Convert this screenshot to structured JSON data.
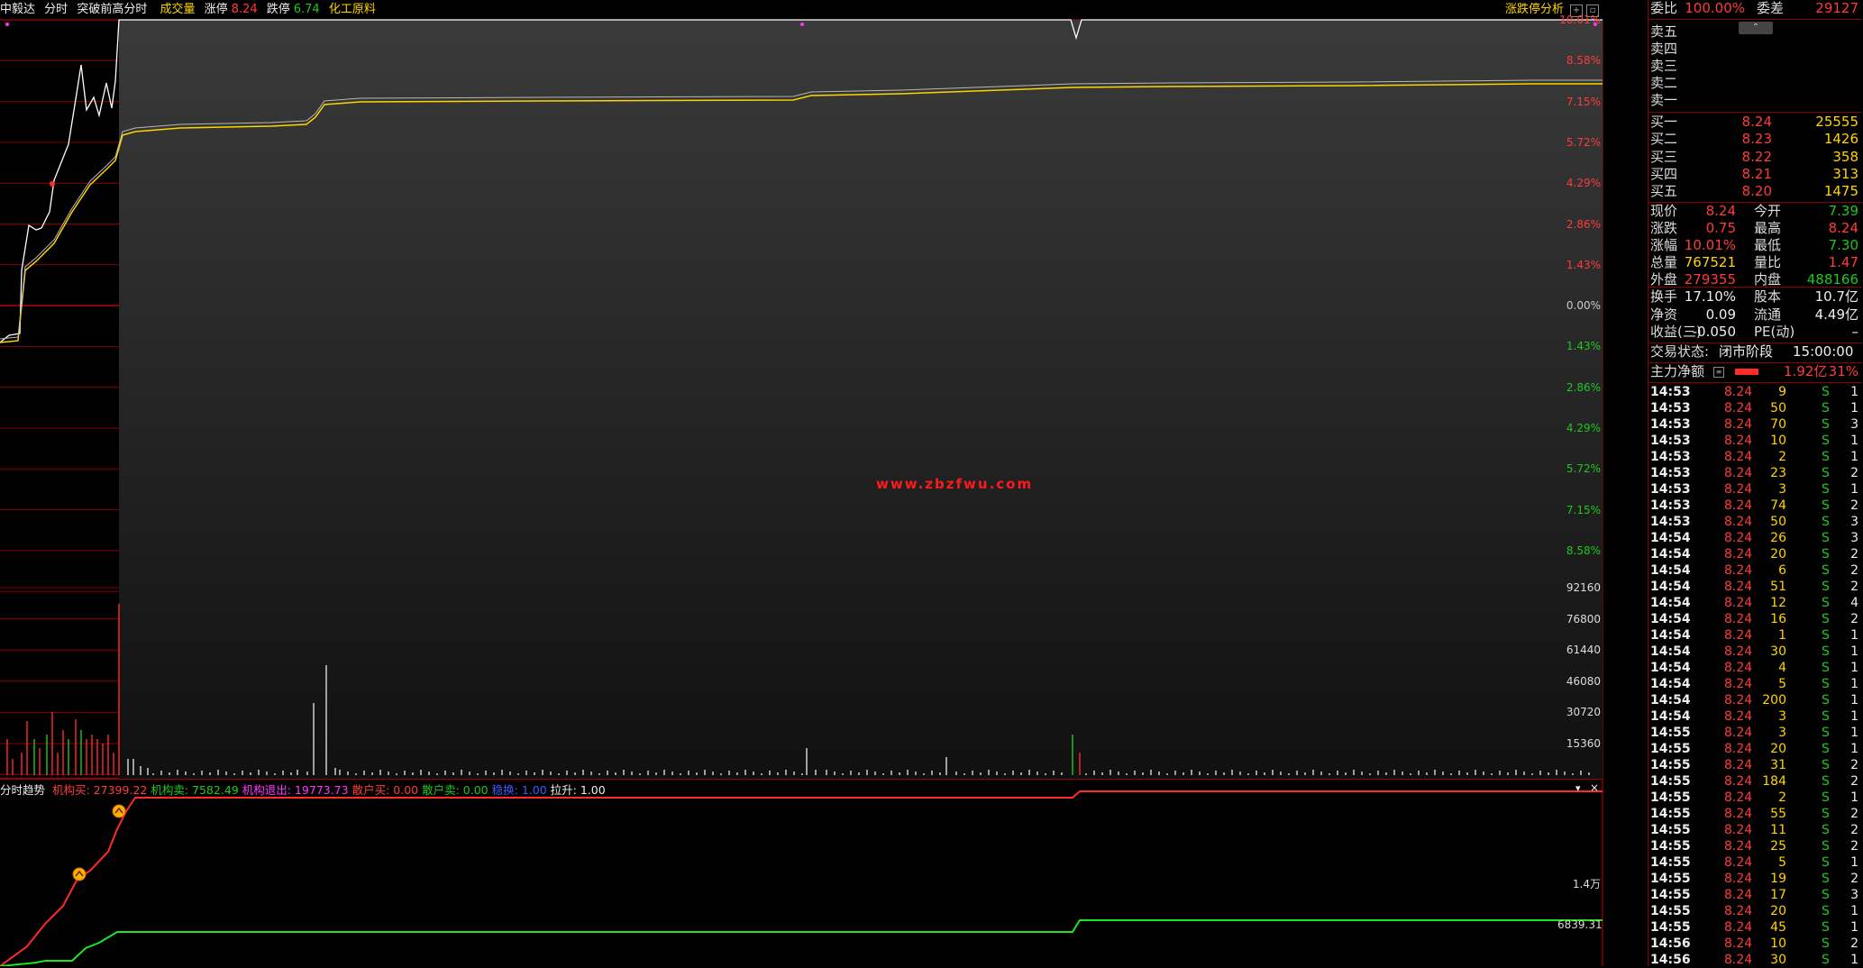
{
  "header": {
    "stock_name": "中毅达",
    "mode": "分时",
    "indicator": "突破前高分时",
    "volume_label": "成交量",
    "limit_up_label": "涨停",
    "limit_up_value": "8.24",
    "limit_down_label": "跌停",
    "limit_down_value": "6.74",
    "industry": "化工原料",
    "analysis_link": "涨跌停分析"
  },
  "price_axis": {
    "right_labels": [
      "10.01%",
      "8.58%",
      "7.15%",
      "5.72%",
      "4.29%",
      "2.86%",
      "1.43%",
      "0.00%",
      "1.43%",
      "2.86%",
      "4.29%",
      "5.72%",
      "7.15%",
      "8.58%"
    ],
    "colors": {
      "up": "#ff3b3b",
      "zero": "#cccccc",
      "down": "#1ec81e"
    }
  },
  "volume_axis": {
    "labels": [
      "92160",
      "76800",
      "61440",
      "46080",
      "30720",
      "15360"
    ]
  },
  "watermark": "www.zbzfwu.com",
  "sub_chart": {
    "title": "分时趋势",
    "items": [
      {
        "label": "机构买:",
        "value": "27399.22",
        "color": "#ff3b3b"
      },
      {
        "label": "机构卖:",
        "value": "7582.49",
        "color": "#1ec81e"
      },
      {
        "label": "机构退出:",
        "value": "19773.73",
        "color": "#ff33ff"
      },
      {
        "label": "散户买:",
        "value": "0.00",
        "color": "#ff3b3b"
      },
      {
        "label": "散户卖:",
        "value": "0.00",
        "color": "#1ec81e"
      },
      {
        "label": "稳换:",
        "value": "1.00",
        "color": "#3b5bff"
      },
      {
        "label": "拉升:",
        "value": "1.00",
        "color": "#eeeeee"
      }
    ],
    "axis_labels": [
      "1.4万",
      "6839.31"
    ]
  },
  "quote": {
    "weibi_label": "委比",
    "weibi_value": "100.00%",
    "weicha_label": "委差",
    "weicha_value": "29127",
    "sell": [
      {
        "label": "卖五",
        "price": "",
        "vol": ""
      },
      {
        "label": "卖四",
        "price": "",
        "vol": ""
      },
      {
        "label": "卖三",
        "price": "",
        "vol": ""
      },
      {
        "label": "卖二",
        "price": "",
        "vol": ""
      },
      {
        "label": "卖一",
        "price": "",
        "vol": ""
      }
    ],
    "buy": [
      {
        "label": "买一",
        "price": "8.24",
        "vol": "25555"
      },
      {
        "label": "买二",
        "price": "8.23",
        "vol": "1426"
      },
      {
        "label": "买三",
        "price": "8.22",
        "vol": "358"
      },
      {
        "label": "买四",
        "price": "8.21",
        "vol": "313"
      },
      {
        "label": "买五",
        "price": "8.20",
        "vol": "1475"
      }
    ],
    "stats": [
      {
        "l1": "现价",
        "v1": "8.24",
        "c1": "red",
        "l2": "今开",
        "v2": "7.39",
        "c2": "green"
      },
      {
        "l1": "涨跌",
        "v1": "0.75",
        "c1": "red",
        "l2": "最高",
        "v2": "8.24",
        "c2": "red"
      },
      {
        "l1": "涨幅",
        "v1": "10.01%",
        "c1": "red",
        "l2": "最低",
        "v2": "7.30",
        "c2": "green"
      },
      {
        "l1": "总量",
        "v1": "767521",
        "c1": "yellow",
        "l2": "量比",
        "v2": "1.47",
        "c2": "red"
      },
      {
        "l1": "外盘",
        "v1": "279355",
        "c1": "red",
        "l2": "内盘",
        "v2": "488166",
        "c2": "green"
      }
    ],
    "stats2": [
      {
        "l1": "换手",
        "v1": "17.10%",
        "l2": "股本",
        "v2": "10.7亿"
      },
      {
        "l1": "净资",
        "v1": "0.09",
        "l2": "流通",
        "v2": "4.49亿"
      },
      {
        "l1": "收益(三)",
        "v1": "-0.050",
        "l2": "PE(动)",
        "v2": "–"
      }
    ],
    "trade_status_label": "交易状态:",
    "trade_status_value": "闭市阶段",
    "trade_time": "15:00:00",
    "main_force_label": "主力净额",
    "main_force_value": "1.92亿",
    "main_force_pct": "31%"
  },
  "ticks": [
    [
      "14:53",
      "8.24",
      "9",
      "S",
      "1"
    ],
    [
      "14:53",
      "8.24",
      "50",
      "S",
      "1"
    ],
    [
      "14:53",
      "8.24",
      "70",
      "S",
      "3"
    ],
    [
      "14:53",
      "8.24",
      "10",
      "S",
      "1"
    ],
    [
      "14:53",
      "8.24",
      "2",
      "S",
      "1"
    ],
    [
      "14:53",
      "8.24",
      "23",
      "S",
      "2"
    ],
    [
      "14:53",
      "8.24",
      "3",
      "S",
      "1"
    ],
    [
      "14:53",
      "8.24",
      "74",
      "S",
      "2"
    ],
    [
      "14:53",
      "8.24",
      "50",
      "S",
      "3"
    ],
    [
      "14:54",
      "8.24",
      "26",
      "S",
      "3"
    ],
    [
      "14:54",
      "8.24",
      "20",
      "S",
      "2"
    ],
    [
      "14:54",
      "8.24",
      "6",
      "S",
      "2"
    ],
    [
      "14:54",
      "8.24",
      "51",
      "S",
      "2"
    ],
    [
      "14:54",
      "8.24",
      "12",
      "S",
      "4"
    ],
    [
      "14:54",
      "8.24",
      "16",
      "S",
      "2"
    ],
    [
      "14:54",
      "8.24",
      "1",
      "S",
      "1"
    ],
    [
      "14:54",
      "8.24",
      "30",
      "S",
      "1"
    ],
    [
      "14:54",
      "8.24",
      "4",
      "S",
      "1"
    ],
    [
      "14:54",
      "8.24",
      "5",
      "S",
      "1"
    ],
    [
      "14:54",
      "8.24",
      "200",
      "S",
      "1"
    ],
    [
      "14:54",
      "8.24",
      "3",
      "S",
      "1"
    ],
    [
      "14:55",
      "8.24",
      "3",
      "S",
      "1"
    ],
    [
      "14:55",
      "8.24",
      "20",
      "S",
      "1"
    ],
    [
      "14:55",
      "8.24",
      "31",
      "S",
      "2"
    ],
    [
      "14:55",
      "8.24",
      "184",
      "S",
      "2"
    ],
    [
      "14:55",
      "8.24",
      "2",
      "S",
      "1"
    ],
    [
      "14:55",
      "8.24",
      "55",
      "S",
      "2"
    ],
    [
      "14:55",
      "8.24",
      "11",
      "S",
      "2"
    ],
    [
      "14:55",
      "8.24",
      "25",
      "S",
      "2"
    ],
    [
      "14:55",
      "8.24",
      "5",
      "S",
      "1"
    ],
    [
      "14:55",
      "8.24",
      "19",
      "S",
      "2"
    ],
    [
      "14:55",
      "8.24",
      "17",
      "S",
      "3"
    ],
    [
      "14:55",
      "8.24",
      "20",
      "S",
      "1"
    ],
    [
      "14:55",
      "8.24",
      "45",
      "S",
      "1"
    ],
    [
      "14:56",
      "8.24",
      "10",
      "S",
      "2"
    ],
    [
      "14:56",
      "8.24",
      "30",
      "S",
      "1"
    ]
  ]
}
